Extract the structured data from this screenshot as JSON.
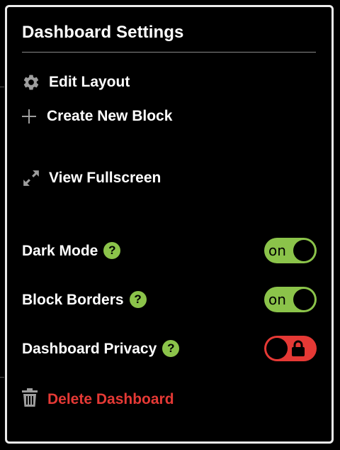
{
  "panel": {
    "title": "Dashboard Settings"
  },
  "menu": {
    "edit_layout": {
      "label": "Edit Layout",
      "icon": "gear-icon"
    },
    "create_block": {
      "label": "Create New Block",
      "icon": "plus-icon"
    },
    "view_fullscreen": {
      "label": "View Fullscreen",
      "icon": "expand-icon"
    }
  },
  "settings": {
    "dark_mode": {
      "label": "Dark Mode",
      "help": "?",
      "state": "on",
      "enabled": true
    },
    "block_borders": {
      "label": "Block Borders",
      "help": "?",
      "state": "on",
      "enabled": true
    },
    "dashboard_privacy": {
      "label": "Dashboard Privacy",
      "help": "?",
      "enabled": false,
      "locked": true
    }
  },
  "danger": {
    "delete_label": "Delete Dashboard",
    "icon": "trash-icon"
  },
  "colors": {
    "accent_green": "#8bc34a",
    "danger_red": "#e53935",
    "border": "#ececec",
    "background": "#000000",
    "icon_gray": "#9e9e9e"
  }
}
